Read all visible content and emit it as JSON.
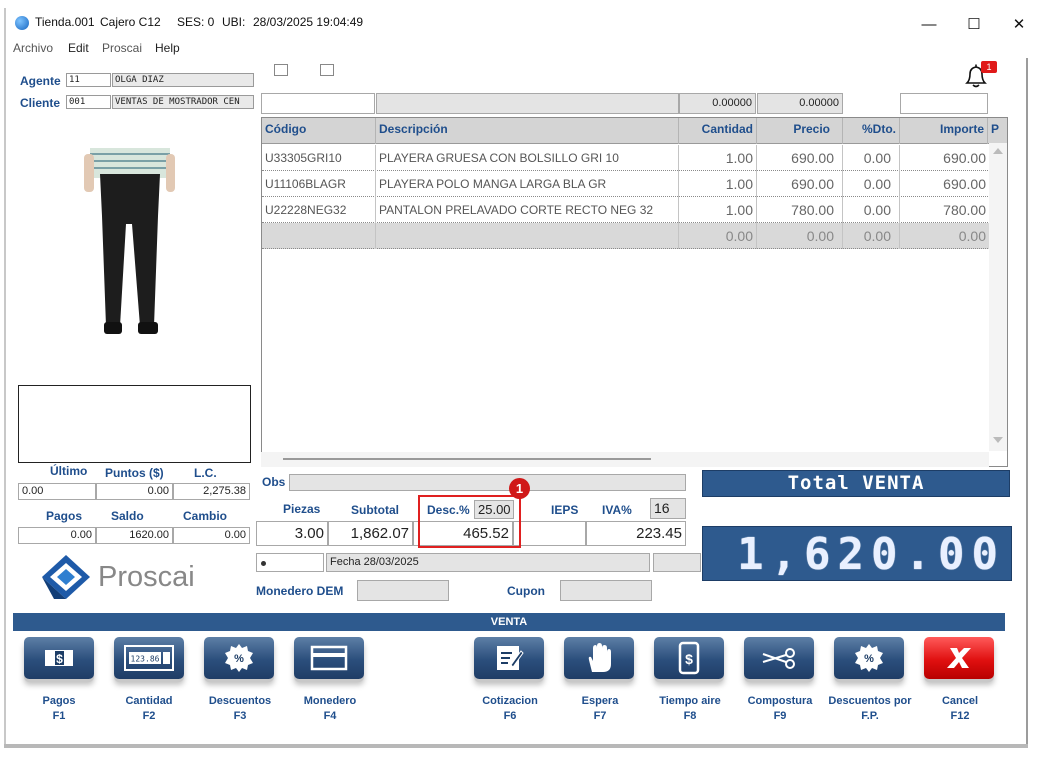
{
  "window": {
    "tienda": "Tienda.001",
    "cajero": "Cajero C12",
    "ses": "SES: 0",
    "ubi": "UBI:",
    "datetime": "28/03/2025 19:04:49",
    "minimize": "—",
    "maximize": "☐",
    "close": "✕"
  },
  "menu": {
    "archivo": "Archivo",
    "edit": "Edit",
    "proscai": "Proscai",
    "help": "Help"
  },
  "header": {
    "agente_label": "Agente",
    "agente_code": "11",
    "agente_name": "OLGA DIAZ",
    "cliente_label": "Cliente",
    "cliente_code": "001",
    "cliente_name": "VENTAS DE MOSTRADOR CEN",
    "notification_count": "1"
  },
  "entry_row": {
    "value1": "0.00000",
    "value2": "0.00000"
  },
  "table": {
    "columns": [
      "Código",
      "Descripción",
      "Cantidad",
      "Precio",
      "%Dto.",
      "Importe",
      "P"
    ],
    "rows": [
      [
        "U33305GRI10",
        "PLAYERA GRUESA CON BOLSILLO GRI 10",
        "1.00",
        "690.00",
        "0.00",
        "690.00"
      ],
      [
        "U11106BLAGR",
        "PLAYERA POLO MANGA LARGA BLA GR",
        "1.00",
        "690.00",
        "0.00",
        "690.00"
      ],
      [
        "U22228NEG32",
        "PANTALON PRELAVADO CORTE RECTO NEG 32",
        "1.00",
        "780.00",
        "0.00",
        "780.00"
      ],
      [
        "",
        "",
        "0.00",
        "0.00",
        "0.00",
        "0.00"
      ]
    ]
  },
  "customer_stats": {
    "ultimo_label": "Último",
    "puntos_label": "Puntos ($)",
    "lc_label": "L.C.",
    "ultimo": "0.00",
    "puntos": "0.00",
    "lc": "2,275.38",
    "pagos_label": "Pagos",
    "saldo_label": "Saldo",
    "cambio_label": "Cambio",
    "pagos": "0.00",
    "saldo": "1620.00",
    "cambio": "0.00"
  },
  "summary": {
    "obs_label": "Obs",
    "piezas_label": "Piezas",
    "subtotal_label": "Subtotal",
    "desc_label": "Desc.%",
    "desc_pct": "25.00",
    "ieps_label": "IEPS",
    "iva_label": "IVA%",
    "iva_pct": "16",
    "piezas": "3.00",
    "subtotal": "1,862.07",
    "desc_amount": "465.52",
    "ieps": "",
    "iva_amount": "223.45",
    "fecha": "Fecha 28/03/2025",
    "monedero_label": "Monedero DEM",
    "cupon_label": "Cupon",
    "callout_number": "1"
  },
  "total": {
    "title": "Total VENTA",
    "value": "1,620.00"
  },
  "brand": "Proscai",
  "toolbar": {
    "section": "VENTA",
    "buttons": [
      {
        "label": "Pagos",
        "key": "F1",
        "icon": "dollar-bill-icon"
      },
      {
        "label": "Cantidad",
        "key": "F2",
        "icon": "calculator-icon"
      },
      {
        "label": "Descuentos",
        "key": "F3",
        "icon": "percent-badge-icon"
      },
      {
        "label": "Monedero",
        "key": "F4",
        "icon": "wallet-card-icon"
      },
      {
        "label": "Cotizacion",
        "key": "F6",
        "icon": "quote-edit-icon"
      },
      {
        "label": "Espera",
        "key": "F7",
        "icon": "hand-stop-icon"
      },
      {
        "label": "Tiempo aire",
        "key": "F8",
        "icon": "phone-credit-icon"
      },
      {
        "label": "Compostura",
        "key": "F9",
        "icon": "scissors-icon"
      },
      {
        "label": "Descuentos por",
        "key": "F.P.",
        "icon": "percent-badge-icon"
      },
      {
        "label": "Cancel",
        "key": "F12",
        "icon": "cancel-x-icon"
      }
    ]
  },
  "colors": {
    "accent": "#2e5a8e",
    "label_blue": "#1f4e8c",
    "highlight": "#e02020",
    "cancel": "#e01010"
  }
}
